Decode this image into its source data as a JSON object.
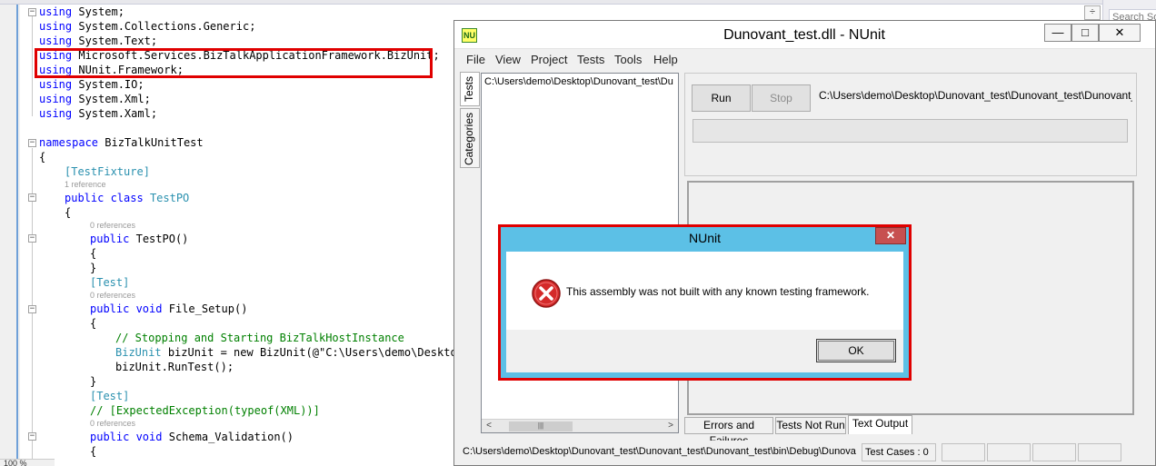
{
  "editor": {
    "zoom": "100 %",
    "code_lines": [
      "using System;",
      "using System.Collections.Generic;",
      "using System.Text;",
      "using Microsoft.Services.BizTalkApplicationFramework.BizUnit;",
      "using NUnit.Framework;",
      "using System.IO;",
      "using System.Xml;",
      "using System.Xaml;",
      "namespace BizTalkUnitTest",
      "{",
      "[TestFixture]",
      "public class TestPO",
      "{",
      "public TestPO()",
      "{",
      "}",
      "[Test]",
      "public void File_Setup()",
      "{",
      "// Stopping and Starting BizTalkHostInstance",
      "BizUnit bizUnit = new BizUnit(@\"C:\\Users\\demo\\Desktop",
      "bizUnit.RunTest();",
      "}",
      "[Test]",
      "// [ExpectedException(typeof(XML))]",
      "public void Schema_Validation()",
      "{"
    ],
    "lens": {
      "one_reference": "1 reference",
      "zero_references": "0 references"
    }
  },
  "ide_right": {
    "search_placeholder": "Search So"
  },
  "nunit": {
    "title": "Dunovant_test.dll - NUnit",
    "logo": "NU",
    "window_buttons": {
      "minimize": "—",
      "maximize": "□",
      "close": "✕"
    },
    "menu": [
      "File",
      "View",
      "Project",
      "Tests",
      "Tools",
      "Help"
    ],
    "side_tabs": [
      "Tests",
      "Categories"
    ],
    "tree_path": "C:\\Users\\demo\\Desktop\\Dunovant_test\\Du",
    "run_label": "Run",
    "stop_label": "Stop",
    "top_path": "C:\\Users\\demo\\Desktop\\Dunovant_test\\Dunovant_test\\Dunovant_...",
    "bottom_tabs": [
      "Errors and Failures",
      "Tests Not Run",
      "Text Output"
    ],
    "status_path": "C:\\Users\\demo\\Desktop\\Dunovant_test\\Dunovant_test\\Dunovant_test\\bin\\Debug\\Dunova",
    "status_testcases": "Test Cases : 0"
  },
  "dialog": {
    "title": "NUnit",
    "close": "✕",
    "message": "This assembly was not built with any known testing framework.",
    "ok_label": "OK"
  },
  "colors": {
    "highlight_red": "#e00000",
    "dialog_title_blue": "#5cc0e6",
    "keyword_blue": "#0000ff",
    "type_teal": "#2b91af",
    "comment_green": "#008000"
  }
}
